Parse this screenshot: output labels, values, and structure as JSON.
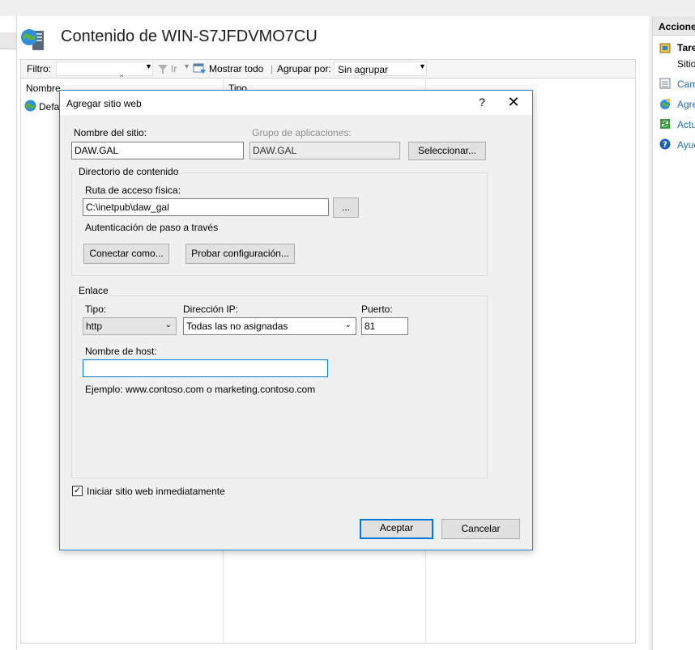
{
  "window": {
    "page_title": "Contenido de WIN-S7JFDVMO7CU"
  },
  "filterbar": {
    "filter_label": "Filtro:",
    "filter_value": "",
    "go_label": "Ir",
    "show_all_label": "Mostrar todo",
    "group_by_label": "Agrupar por:",
    "group_by_value": "Sin agrupar"
  },
  "list": {
    "col_name": "Nombre",
    "col_type": "Tipo",
    "rows": [
      {
        "name": "Defa"
      }
    ]
  },
  "actions_panel": {
    "header": "Acciones",
    "section": "Tare",
    "section_sub": "Sitio",
    "items": [
      {
        "label": "Cam",
        "icon": "view-icon"
      },
      {
        "label": "Agre",
        "icon": "add-site-icon"
      },
      {
        "label": "Actu",
        "icon": "refresh-icon"
      },
      {
        "label": "Ayud",
        "icon": "help-icon"
      }
    ]
  },
  "dialog": {
    "title": "Agregar sitio web",
    "help_glyph": "?",
    "close_glyph": "✕",
    "site_name_label": "Nombre del sitio:",
    "site_name_value": "DAW.GAL",
    "app_pool_label": "Grupo de aplicaciones:",
    "app_pool_value": "DAW.GAL",
    "select_button": "Seleccionar...",
    "content_dir_group": "Directorio de contenido",
    "physical_path_label": "Ruta de acceso física:",
    "physical_path_value": "C:\\inetpub\\daw_gal",
    "browse_button": "...",
    "passthrough_label": "Autenticación de paso a través",
    "connect_as_button": "Conectar como...",
    "test_settings_button": "Probar configuración...",
    "binding_group": "Enlace",
    "type_label": "Tipo:",
    "type_value": "http",
    "ip_label": "Dirección IP:",
    "ip_value": "Todas las no asignadas",
    "port_label": "Puerto:",
    "port_value": "81",
    "hostname_label": "Nombre de host:",
    "hostname_value": "",
    "example_text": "Ejemplo: www.contoso.com o marketing.contoso.com",
    "start_immediately_label": "Iniciar sitio web inmediatamente",
    "start_immediately_checked": "✓",
    "ok_button": "Aceptar",
    "cancel_button": "Cancelar"
  },
  "colors": {
    "accent": "#0078d7",
    "link": "#1a6fb7",
    "dialog_bg": "#f0f0f0"
  }
}
